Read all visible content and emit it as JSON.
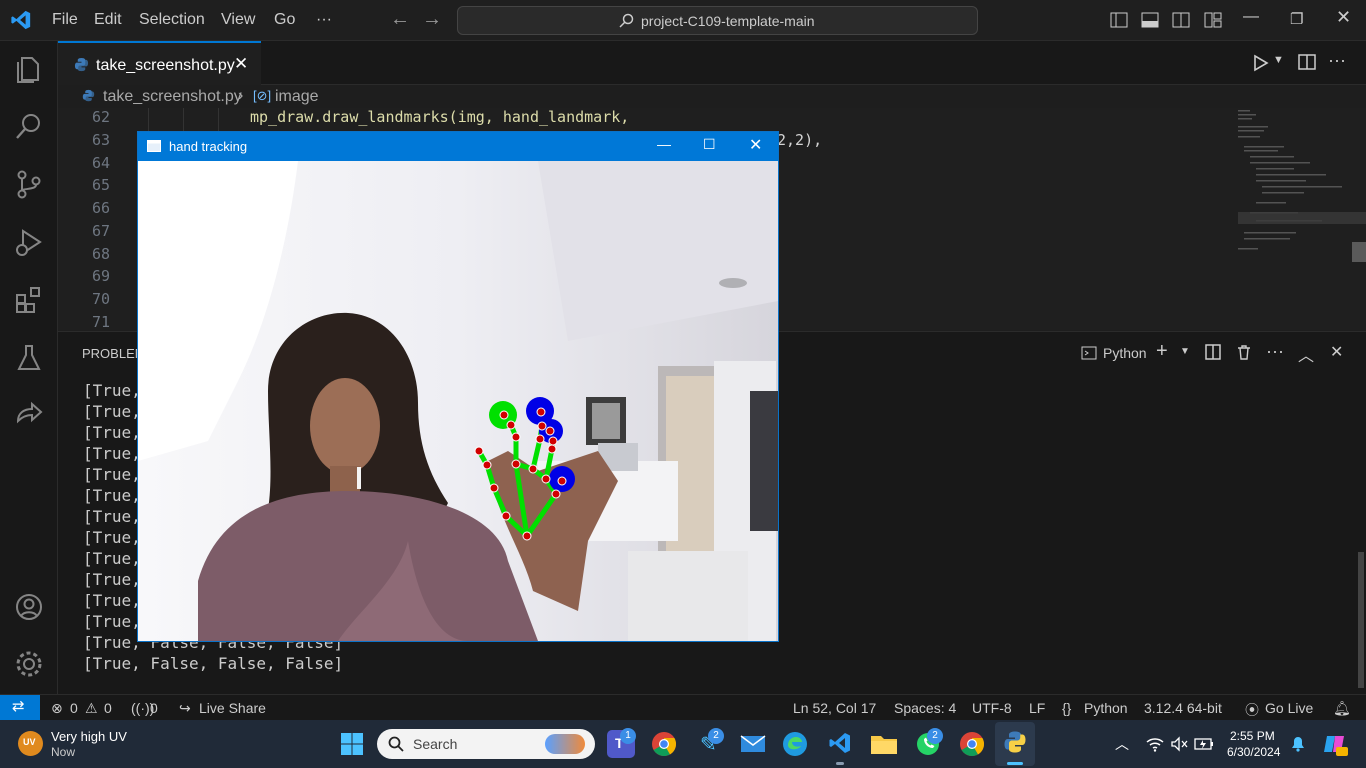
{
  "titlebar": {
    "menu": [
      "File",
      "Edit",
      "Selection",
      "View",
      "Go",
      "···"
    ],
    "search_text": "project-C109-template-main"
  },
  "editor": {
    "tab_label": "take_screenshot.py",
    "breadcrumb_file": "take_screenshot.py",
    "breadcrumb_symbol": "image",
    "line_numbers": [
      "62",
      "63",
      "64",
      "65",
      "66",
      "67",
      "68",
      "69",
      "70",
      "71"
    ],
    "code_line_62": "mp_draw.draw_landmarks(img, hand_landmark,",
    "code_line_63_tail": "2,2),"
  },
  "panel": {
    "problems_tab": "PROBLEMS",
    "terminal_name": "Python",
    "output_lines": [
      "[True,",
      "[True,",
      "[True,",
      "[True,",
      "[True,",
      "[True,",
      "[True,",
      "[True,",
      "[True,",
      "[True,",
      "[True,",
      "[True,",
      "[True, False, False, False]",
      "[True, False, False, False]"
    ]
  },
  "statusbar": {
    "errors": "0",
    "warnings": "0",
    "ports": "0",
    "live_share": "Live Share",
    "position": "Ln 52, Col 17",
    "spaces": "Spaces: 4",
    "encoding": "UTF-8",
    "eol": "LF",
    "language": "Python",
    "interpreter": "3.12.4 64-bit",
    "go_live": "Go Live"
  },
  "hand_window": {
    "title": "hand tracking"
  },
  "taskbar": {
    "weather_title": "Very high UV",
    "weather_sub": "Now",
    "weather_badge": "UV",
    "search_placeholder": "Search",
    "teams_badge": "1",
    "app_badge": "2",
    "whatsapp_badge": "2",
    "time": "2:55 PM",
    "date": "6/30/2024"
  },
  "colors": {
    "accent": "#0078d4",
    "editor_bg": "#1f1f1f",
    "landmark_point": "#d10000",
    "landmark_line": "#00e000",
    "fingertip_blue": "#0000e6"
  }
}
